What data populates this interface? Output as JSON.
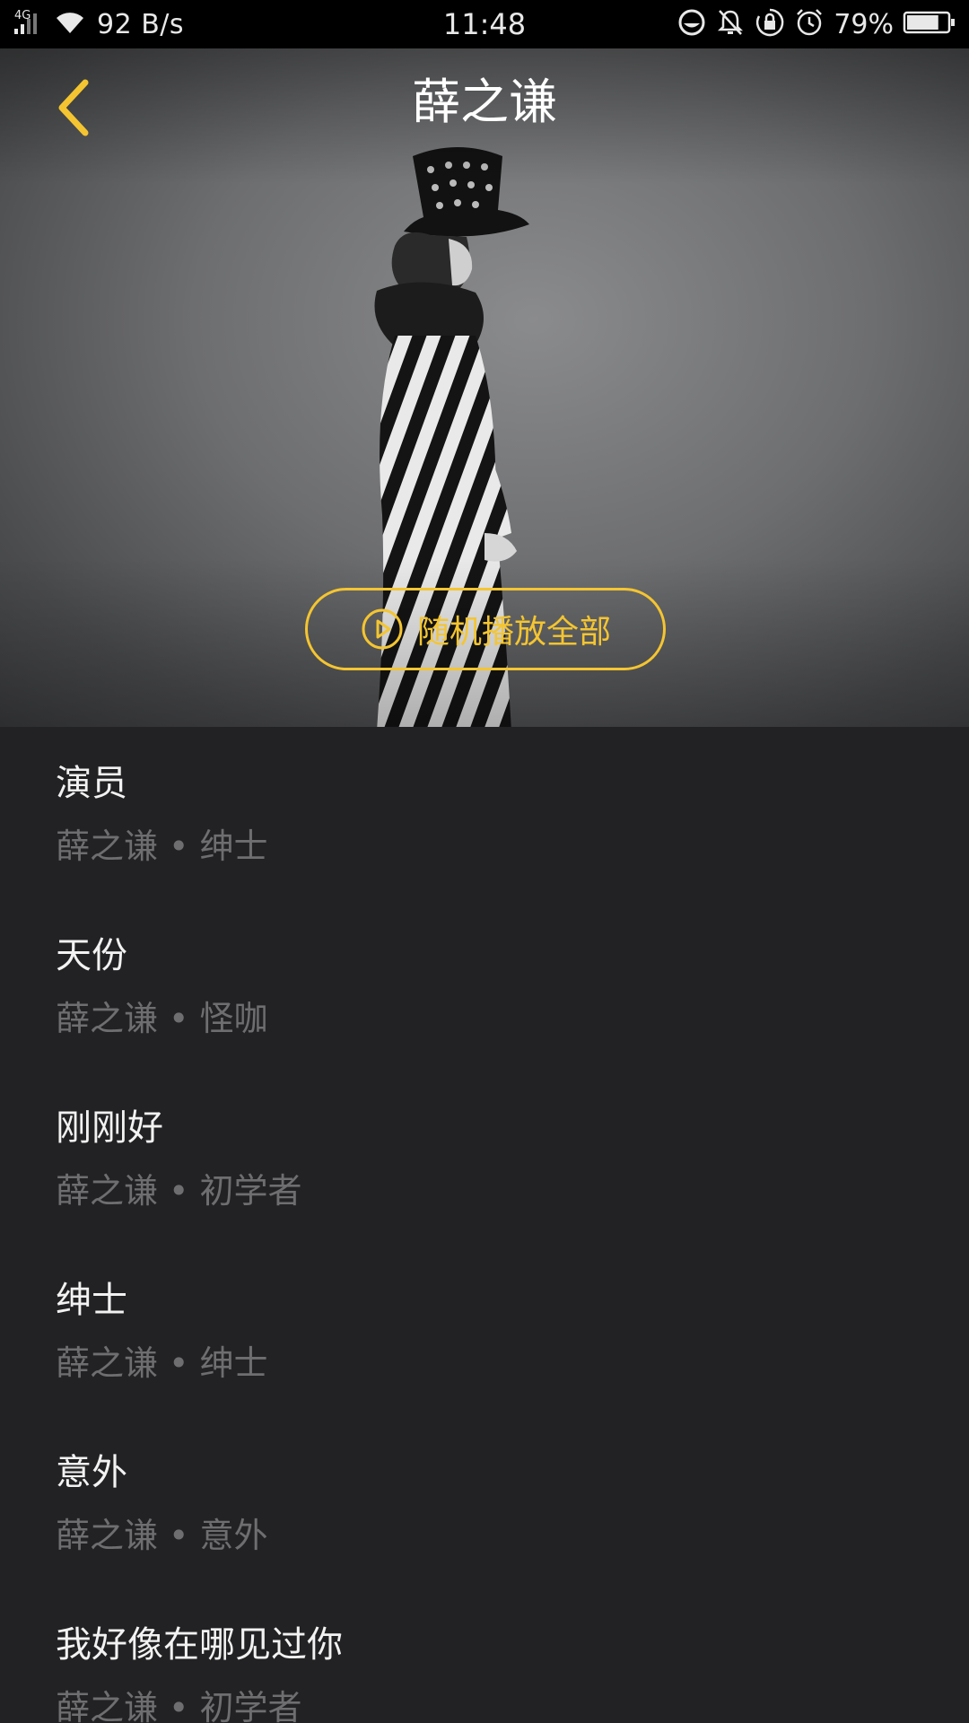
{
  "status_bar": {
    "network": "4G",
    "speed": "92 B/s",
    "time": "11:48",
    "battery": "79%",
    "battery_level": 0.79,
    "icons": [
      "signal-icon",
      "wifi-icon",
      "message-icon",
      "muted-bell-icon",
      "rotation-lock-icon",
      "alarm-icon",
      "battery-icon"
    ]
  },
  "header": {
    "title": "薛之谦",
    "back_icon": "chevron-left-icon"
  },
  "hero": {
    "shuffle_label": "随机播放全部",
    "shuffle_icon": "play-circle-icon"
  },
  "colors": {
    "accent": "#f4c531",
    "background": "#222224",
    "subtitle": "#6e6e70"
  },
  "songs": [
    {
      "title": "演员",
      "artist": "薛之谦",
      "separator": "•",
      "album": "绅士"
    },
    {
      "title": "天份",
      "artist": "薛之谦",
      "separator": "•",
      "album": "怪咖"
    },
    {
      "title": "刚刚好",
      "artist": "薛之谦",
      "separator": "•",
      "album": "初学者"
    },
    {
      "title": "绅士",
      "artist": "薛之谦",
      "separator": "•",
      "album": "绅士"
    },
    {
      "title": "意外",
      "artist": "薛之谦",
      "separator": "•",
      "album": "意外"
    },
    {
      "title": "我好像在哪见过你",
      "artist": "薛之谦",
      "separator": "•",
      "album": "初学者"
    }
  ]
}
